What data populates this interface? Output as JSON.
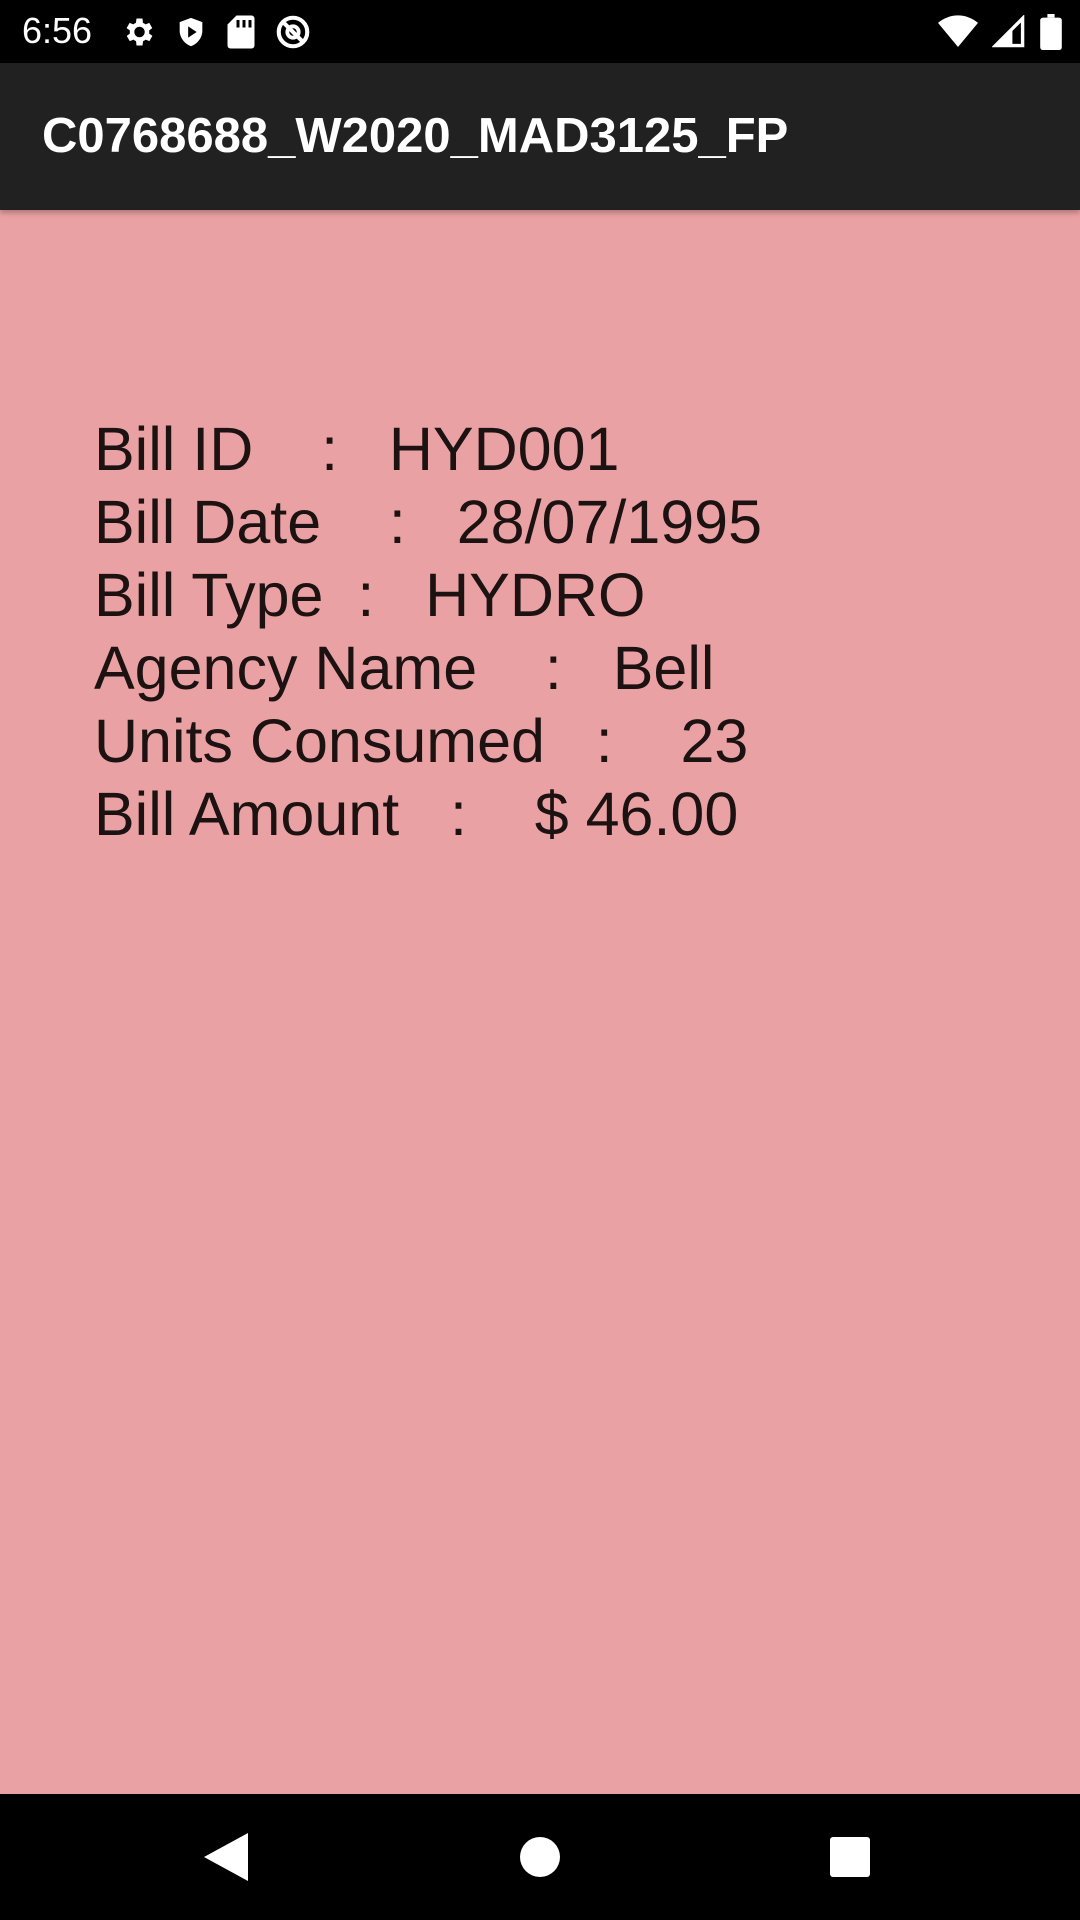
{
  "status_bar": {
    "time": "6:56",
    "left_icons": [
      "settings-icon",
      "shield-play-icon",
      "sd-card-icon",
      "no-sign-icon"
    ],
    "right_icons": [
      "wifi-icon",
      "cellular-signal-icon",
      "battery-icon"
    ]
  },
  "app_bar": {
    "title": "C0768688_W2020_MAD3125_FP"
  },
  "bill_details": {
    "bill_id": "Bill ID    :   HYD001",
    "bill_date": "Bill Date    :   28/07/1995",
    "bill_type": "Bill Type  :   HYDRO",
    "agency_name": "Agency Name    :   Bell",
    "units_consumed": "Units Consumed   :    23",
    "bill_amount": "Bill Amount   :    $ 46.00"
  },
  "nav_bar": {
    "buttons": [
      "back-icon",
      "home-icon",
      "recents-icon"
    ]
  },
  "colors": {
    "background": "#eaa1a3",
    "app_bar": "#212121",
    "status_bar": "#000000",
    "text": "#1c1212"
  }
}
